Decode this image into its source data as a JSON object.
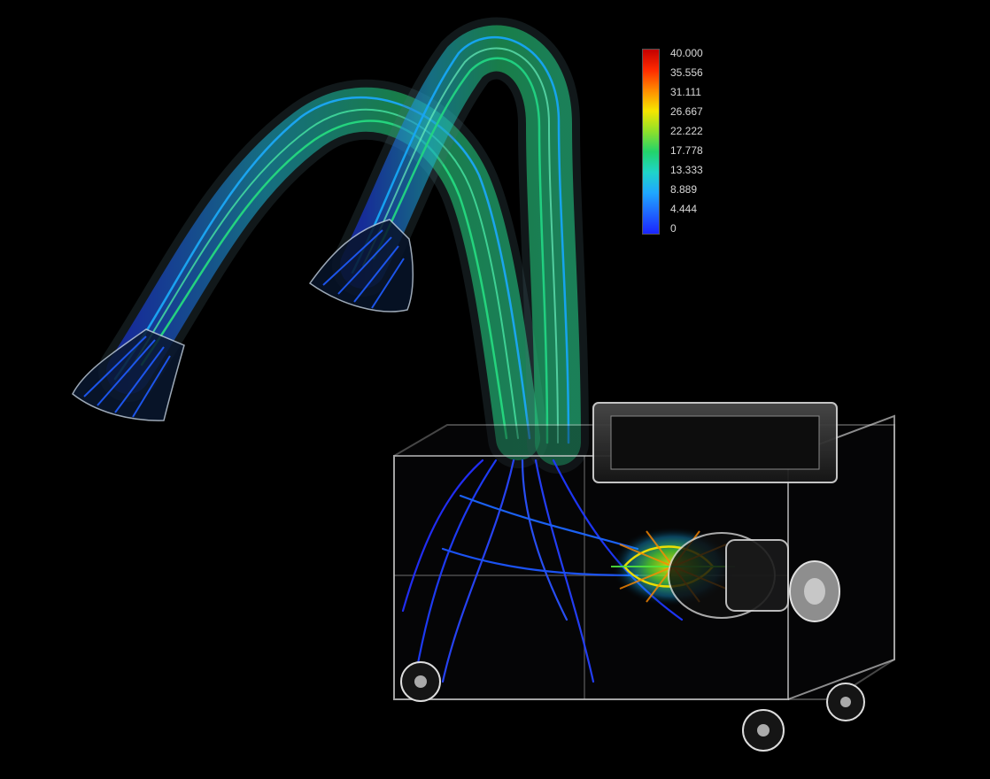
{
  "legend": {
    "labels": [
      "40.000",
      "35.556",
      "31.111",
      "26.667",
      "22.222",
      "17.778",
      "13.333",
      "8.889",
      "4.444",
      "0"
    ],
    "colors": [
      "#c40000",
      "#ff2a00",
      "#ff8c00",
      "#f5e600",
      "#8fe02a",
      "#22d36b",
      "#1fd4c9",
      "#1fa7ff",
      "#1f66ff",
      "#1a24ff"
    ]
  }
}
